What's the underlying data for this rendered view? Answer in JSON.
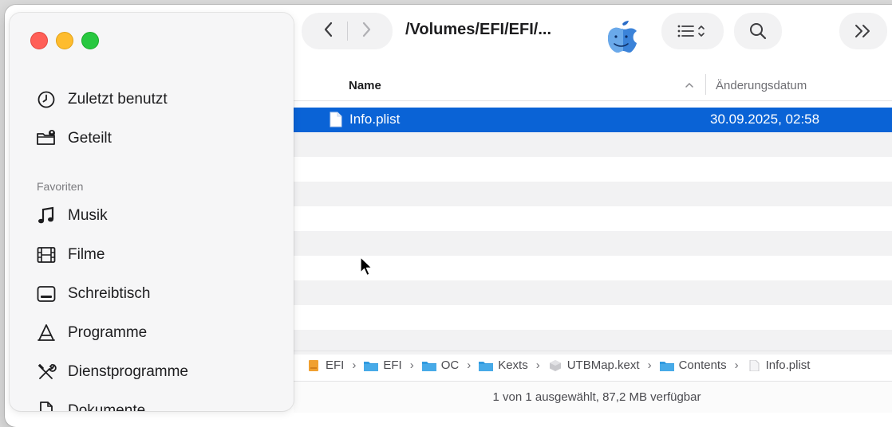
{
  "toolbar": {
    "path_title": "/Volumes/EFI/EFI/...",
    "back_icon": "chevron-left-icon",
    "forward_icon": "chevron-right-icon",
    "view_icon": "list-view-icon",
    "search_icon": "magnifier-icon",
    "more_icon": "double-chevron-right-icon"
  },
  "sidebar": {
    "items": [
      {
        "label": "Zuletzt benutzt",
        "icon": "clock-icon"
      },
      {
        "label": "Geteilt",
        "icon": "shared-folder-icon"
      }
    ],
    "favorites_heading": "Favoriten",
    "favorites": [
      {
        "label": "Musik",
        "icon": "music-note-icon"
      },
      {
        "label": "Filme",
        "icon": "film-icon"
      },
      {
        "label": "Schreibtisch",
        "icon": "desktop-icon"
      },
      {
        "label": "Programme",
        "icon": "apps-icon"
      },
      {
        "label": "Dienstprogramme",
        "icon": "tools-icon"
      },
      {
        "label": "Dokumente",
        "icon": "document-icon"
      }
    ]
  },
  "columns": {
    "name": "Name",
    "sort_indicator": "^",
    "date": "Änderungsdatum"
  },
  "files": [
    {
      "name": "Info.plist",
      "date": "30.09.2025, 02:58",
      "selected": true
    }
  ],
  "pathbar": [
    {
      "label": "EFI",
      "icon": "drive-icon"
    },
    {
      "label": "EFI",
      "icon": "folder-icon"
    },
    {
      "label": "OC",
      "icon": "folder-icon"
    },
    {
      "label": "Kexts",
      "icon": "folder-icon"
    },
    {
      "label": "UTBMap.kext",
      "icon": "kext-icon"
    },
    {
      "label": "Contents",
      "icon": "folder-icon"
    },
    {
      "label": "Info.plist",
      "icon": "file-icon"
    }
  ],
  "status": "1 von 1 ausgewählt, 87,2 MB verfügbar",
  "colors": {
    "selection": "#0a63d6",
    "folder": "#2f9ae0",
    "close": "#ff5f57",
    "minimize": "#febc2e",
    "maximize": "#28c840"
  }
}
